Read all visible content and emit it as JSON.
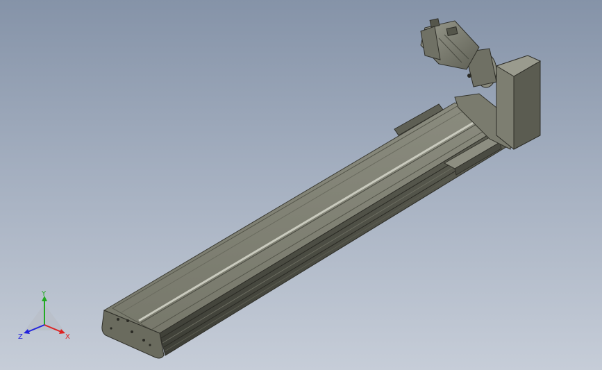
{
  "viewport": {
    "background_top": "#8593a8",
    "background_bottom": "#c6cdd8"
  },
  "model": {
    "name": "linear-actuator-assembly",
    "components": [
      "rail-body",
      "carriage-block",
      "end-cap",
      "gearbox-housing",
      "servo-motor"
    ]
  },
  "triad": {
    "y_label": "Y",
    "x_label": "X",
    "z_label": "Z",
    "colors": {
      "y": "#22aa22",
      "x": "#dd2222",
      "z": "#2222dd"
    }
  }
}
